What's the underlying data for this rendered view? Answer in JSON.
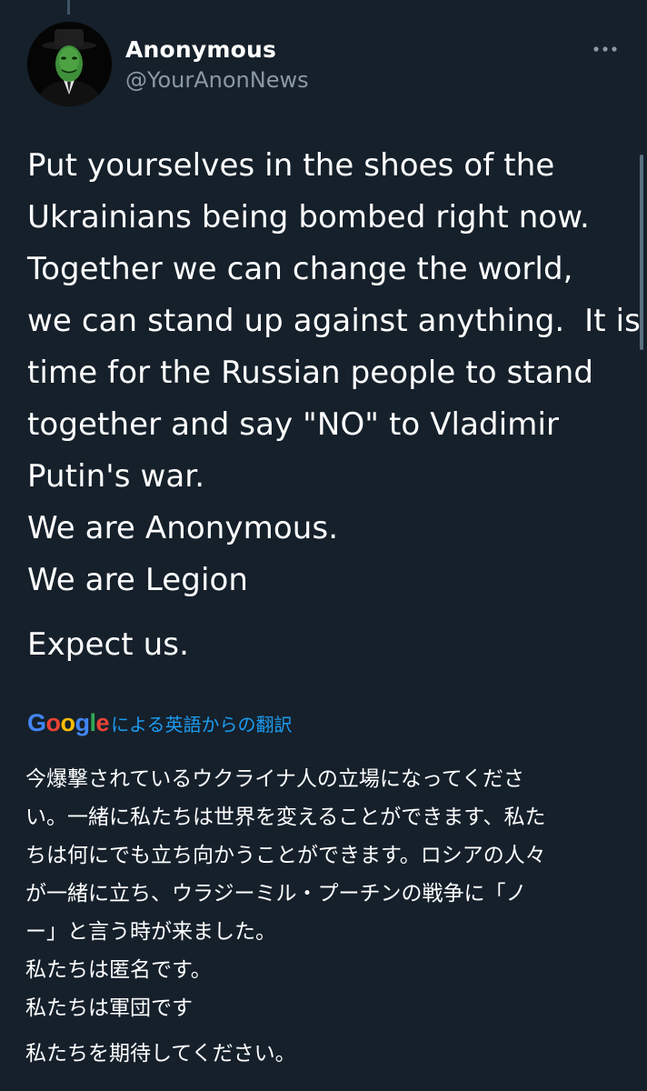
{
  "author": {
    "display_name": "Anonymous",
    "handle": "@YourAnonNews",
    "avatar_icon": "guy-fawkes-mask-avatar"
  },
  "menu": {
    "more_icon": "more-horizontal-icon"
  },
  "tweet": {
    "lines": [
      "Put yourselves in the shoes of the",
      "Ukrainians being bombed right now.",
      "Together we can change the world,",
      "we can stand up against anything.  It is",
      "time for the Russian people to stand",
      "together and say \"NO\" to Vladimir",
      "Putin's war.",
      "We are Anonymous.",
      "We are Legion",
      "Expect us."
    ]
  },
  "translation": {
    "provider": "Google",
    "label": "による英語からの翻訳",
    "lines": [
      "今爆撃されているウクライナ人の立場になってくださ",
      "い。一緒に私たちは世界を変えることができます、私た",
      "ちは何にでも立ち向かうことができます。ロシアの人々",
      "が一緒に立ち、ウラジーミル・プーチンの戦争に「ノ",
      "ー」と言う時が来ました。",
      "私たちは匿名です。",
      "私たちは軍団です",
      "私たちを期待してください。"
    ]
  },
  "colors": {
    "background": "#15202b",
    "text_primary": "#ffffff",
    "text_secondary": "#8b98a5",
    "link": "#1d9bf0",
    "google_blue": "#4285f4",
    "google_red": "#ea4335",
    "google_yellow": "#fbbc05",
    "google_green": "#34a853"
  }
}
